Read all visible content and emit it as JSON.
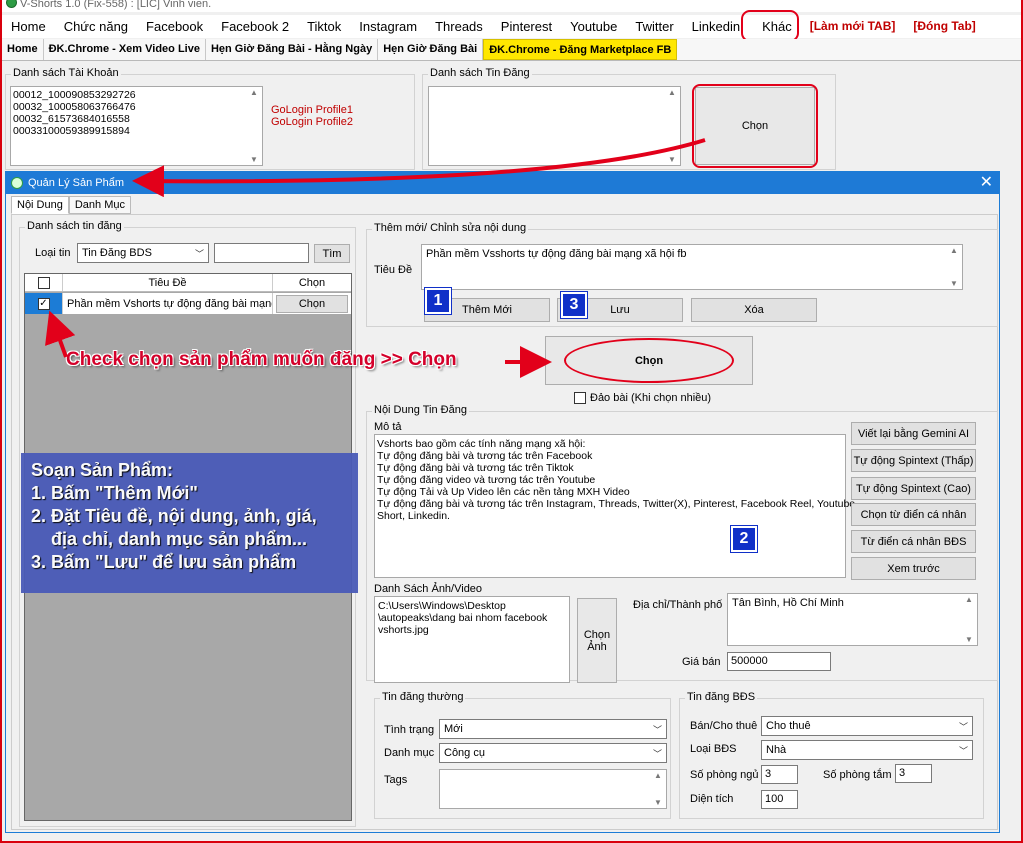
{
  "window": {
    "title": "V-Shorts 1.0 (Fix-558) : [LIC] Vinh vien."
  },
  "menu": [
    "Home",
    "Chức năng",
    "Facebook",
    "Facebook 2",
    "Tiktok",
    "Instagram",
    "Threads",
    "Pinterest",
    "Youtube",
    "Twitter",
    "Linkedin",
    "Khác"
  ],
  "menu_red": [
    "[Làm mới TAB]",
    "[Đóng Tab]"
  ],
  "subtabs": [
    "Home",
    "ĐK.Chrome - Xem Video Live",
    "Hẹn Giờ Đăng Bài - Hằng Ngày",
    "Hẹn Giờ Đăng Bài",
    "ĐK.Chrome - Đăng Marketplace FB"
  ],
  "accounts": {
    "label": "Danh sách Tài Khoản",
    "items": [
      "00012_100090853292726",
      "00032_100058063766476",
      "00032_61573684016558",
      "00033100059389915894"
    ],
    "profiles": [
      "GoLogin Profile1",
      "GoLogin Profile2"
    ]
  },
  "posts_group": {
    "label": "Danh sách Tin Đăng",
    "choose": "Chọn"
  },
  "dialog": {
    "title": "Quản Lý Sản Phẩm",
    "tabs": [
      "Nội Dung",
      "Danh Mục"
    ],
    "list_group": "Danh sách tin đăng",
    "type_label": "Loại tin",
    "type_value": "Tin Đăng BDS",
    "search_button": "Tìm",
    "columns": [
      "Tiêu Đề",
      "Chọn"
    ],
    "row": {
      "title": "Phần mềm Vshorts tự động đăng bài mạng ...",
      "button": "Chọn"
    },
    "edit_group": "Thêm mới/ Chỉnh sửa nội dung",
    "title_label": "Tiêu Đề",
    "title_value": "Phần mềm Vsshorts tự động đăng bài mạng xã hội fb",
    "add_button": "Thêm Mới",
    "save_button": "Lưu",
    "delete_button": "Xóa",
    "choose_button": "Chọn",
    "shuffle_label": "Đảo bài (Khi chọn nhiều)",
    "content_group": "Nội Dung Tin Đăng",
    "desc_label": "Mô tả",
    "desc_lines": [
      "Vshorts bao gồm các tính năng mạng xã hội:",
      "Tự động đăng bài và tương tác trên Facebook",
      "Tự động đăng bài và tương tác trên Tiktok",
      "Tự động đăng video và tương tác trên Youtube",
      "Tự động Tải và Up Video lên các nền tảng MXH Video",
      "Tự động đăng bài và tương tác trên Instagram, Threads, Twitter(X), Pinterest, Facebook Reel, Youtube",
      "Short, Linkedin."
    ],
    "side_buttons": [
      "Viết lại bằng Gemini AI",
      "Tự động Spintext (Thấp)",
      "Tự động Spintext (Cao)",
      "Chọn từ điển cá nhân",
      "Từ điển cá nhân BĐS",
      "Xem trước"
    ],
    "media_label": "Danh Sách Ảnh/Video",
    "media_lines": [
      "C:\\Users\\Windows\\Desktop",
      "\\autopeaks\\dang bai nhom facebook",
      "vshorts.jpg"
    ],
    "choose_image": "Chọn Ảnh",
    "address_label": "Địa chỉ/Thành phố",
    "address_value": "Tân Bình, Hồ Chí Minh",
    "price_label": "Giá bán",
    "price_value": "500000",
    "normal_group": "Tin đăng thường",
    "status_label": "Tình trạng",
    "status_value": "Mới",
    "category_label": "Danh mục",
    "category_value": "Công cụ",
    "tags_label": "Tags",
    "bds_group": "Tin đăng BĐS",
    "sale_label": "Bán/Cho thuê",
    "sale_value": "Cho thuê",
    "bds_type_label": "Loại BĐS",
    "bds_type_value": "Nhà",
    "bedrooms_label": "Số phòng ngủ",
    "bedrooms_value": "3",
    "baths_label": "Số phòng tắm",
    "baths_value": "3",
    "area_label": "Diện tích",
    "area_value": "100"
  },
  "annotations": {
    "check_text": "Check chọn sản phẩm muốn đăng >> Chọn",
    "badges": [
      "1",
      "2",
      "3"
    ],
    "instructions": [
      "Soạn Sản Phẩm:",
      "1. Bấm \"Thêm Mới\"",
      "2. Đặt Tiêu đề, nội dung, ảnh, giá,",
      "    địa chỉ, danh mục sản phẩm...",
      "3. Bấm \"Lưu\" để lưu sản phẩm"
    ]
  }
}
